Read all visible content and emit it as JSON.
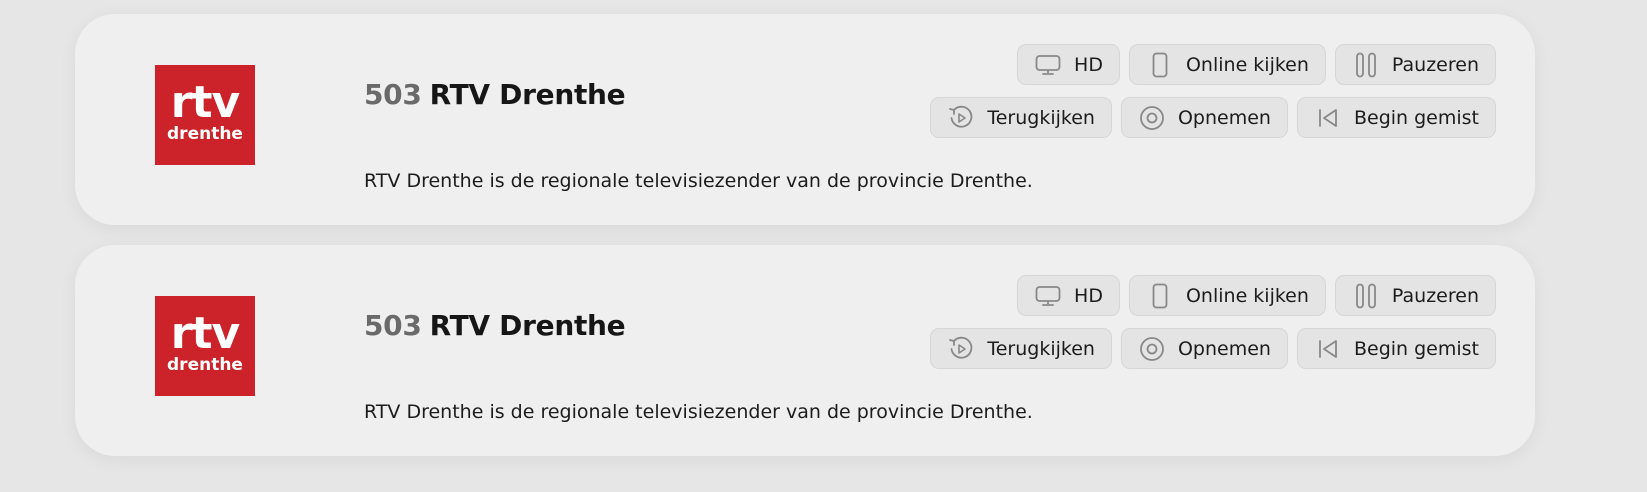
{
  "channels": [
    {
      "logo": {
        "top": "rtv",
        "bottom": "drenthe",
        "color": "#cc2229"
      },
      "number": "503",
      "name": "RTV Drenthe",
      "description": "RTV Drenthe is de regionale televisiezender van de provincie Drenthe.",
      "row1": [
        {
          "icon": "monitor-icon",
          "label": "HD"
        },
        {
          "icon": "phone-icon",
          "label": "Online kijken"
        },
        {
          "icon": "pause-icon",
          "label": "Pauzeren"
        }
      ],
      "row2": [
        {
          "icon": "replay-icon",
          "label": "Terugkijken"
        },
        {
          "icon": "record-icon",
          "label": "Opnemen"
        },
        {
          "icon": "skip-back-icon",
          "label": "Begin gemist"
        }
      ]
    },
    {
      "logo": {
        "top": "rtv",
        "bottom": "drenthe",
        "color": "#cc2229"
      },
      "number": "503",
      "name": "RTV Drenthe",
      "description": "RTV Drenthe is de regionale televisiezender van de provincie Drenthe.",
      "row1": [
        {
          "icon": "monitor-icon",
          "label": "HD"
        },
        {
          "icon": "phone-icon",
          "label": "Online kijken"
        },
        {
          "icon": "pause-icon",
          "label": "Pauzeren"
        }
      ],
      "row2": [
        {
          "icon": "replay-icon",
          "label": "Terugkijken"
        },
        {
          "icon": "record-icon",
          "label": "Opnemen"
        },
        {
          "icon": "skip-back-icon",
          "label": "Begin gemist"
        }
      ]
    }
  ]
}
